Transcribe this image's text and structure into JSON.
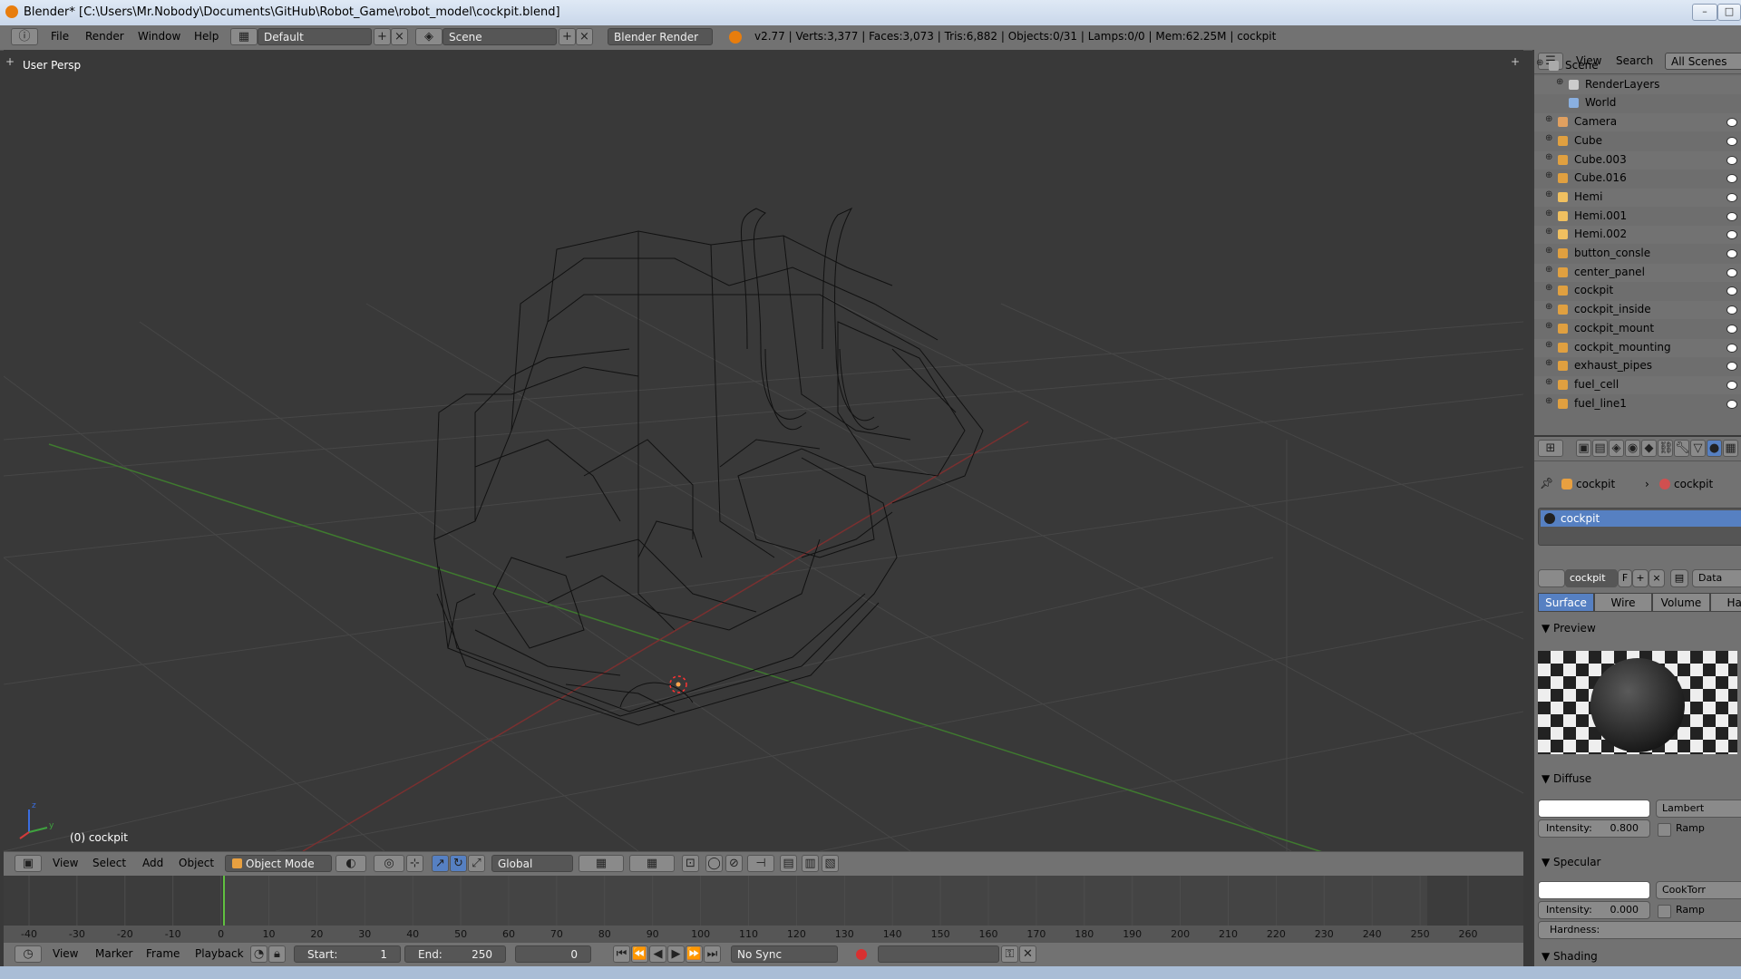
{
  "window": {
    "title": "Blender* [C:\\Users\\Mr.Nobody\\Documents\\GitHub\\Robot_Game\\robot_model\\cockpit.blend]"
  },
  "info_header": {
    "menus": [
      "File",
      "Render",
      "Window",
      "Help"
    ],
    "layout": "Default",
    "scene": "Scene",
    "engine": "Blender Render",
    "stats": "v2.77 | Verts:3,377 | Faces:3,073 | Tris:6,882 | Objects:0/31 | Lamps:0/0 | Mem:62.25M | cockpit"
  },
  "viewport": {
    "view_label": "User Persp",
    "object_label": "(0) cockpit"
  },
  "view3d_header": {
    "menus": [
      "View",
      "Select",
      "Add",
      "Object"
    ],
    "mode": "Object Mode",
    "orientation": "Global"
  },
  "timeline": {
    "ticks": [
      "-40",
      "-30",
      "-20",
      "-10",
      "0",
      "10",
      "20",
      "30",
      "40",
      "50",
      "60",
      "70",
      "80",
      "90",
      "100",
      "110",
      "120",
      "130",
      "140",
      "150",
      "160",
      "170",
      "180",
      "190",
      "200",
      "210",
      "220",
      "230",
      "240",
      "250",
      "260"
    ],
    "current_frame": "0"
  },
  "timeline_header": {
    "menus": [
      "View",
      "Marker",
      "Frame",
      "Playback"
    ],
    "start_label": "Start:",
    "start": "1",
    "end_label": "End:",
    "end": "250",
    "frame": "0",
    "sync": "No Sync"
  },
  "outliner": {
    "menus": [
      "View",
      "Search"
    ],
    "filter": "All Scenes",
    "items": [
      {
        "label": "Scene",
        "type": "scene"
      },
      {
        "label": "RenderLayers",
        "type": "renderlayers"
      },
      {
        "label": "World",
        "type": "world"
      },
      {
        "label": "Camera",
        "type": "camera"
      },
      {
        "label": "Cube",
        "type": "mesh"
      },
      {
        "label": "Cube.003",
        "type": "mesh"
      },
      {
        "label": "Cube.016",
        "type": "mesh"
      },
      {
        "label": "Hemi",
        "type": "lamp"
      },
      {
        "label": "Hemi.001",
        "type": "lamp"
      },
      {
        "label": "Hemi.002",
        "type": "lamp"
      },
      {
        "label": "button_consle",
        "type": "mesh"
      },
      {
        "label": "center_panel",
        "type": "mesh"
      },
      {
        "label": "cockpit",
        "type": "mesh"
      },
      {
        "label": "cockpit_inside",
        "type": "mesh"
      },
      {
        "label": "cockpit_mount",
        "type": "mesh"
      },
      {
        "label": "cockpit_mounting",
        "type": "mesh"
      },
      {
        "label": "exhaust_pipes",
        "type": "mesh"
      },
      {
        "label": "fuel_cell",
        "type": "mesh"
      },
      {
        "label": "fuel_line1",
        "type": "mesh"
      }
    ]
  },
  "properties": {
    "breadcrumb_object": "cockpit",
    "breadcrumb_material": "cockpit",
    "material_slot": "cockpit",
    "material_name": "cockpit",
    "material_fake_user": "F",
    "data_label": "Data",
    "tabs": [
      "Surface",
      "Wire",
      "Volume",
      "Halo"
    ],
    "preview_label": "Preview",
    "diffuse": {
      "label": "Diffuse",
      "shader": "Lambert",
      "intensity_label": "Intensity:",
      "intensity": "0.800",
      "ramp_label": "Ramp",
      "color": "#ffffff"
    },
    "specular": {
      "label": "Specular",
      "shader": "CookTorr",
      "intensity_label": "Intensity:",
      "intensity": "0.000",
      "ramp_label": "Ramp",
      "hardness_label": "Hardness:",
      "color": "#ffffff"
    },
    "shading_label": "Shading"
  }
}
